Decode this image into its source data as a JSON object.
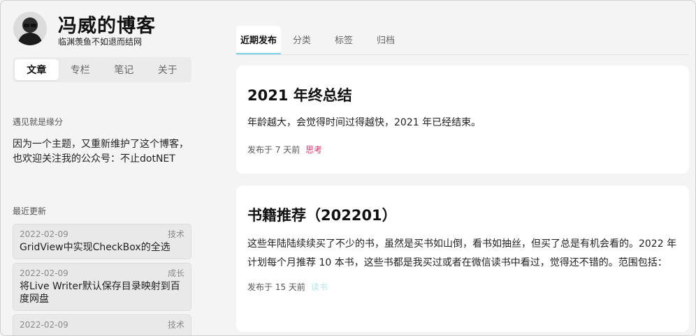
{
  "colors": {
    "accent": "#7dd0e4",
    "tag_think": "#d6336c",
    "tag_reading": "#b6e4ef",
    "background": "#f4f4f4",
    "card": "#ffffff"
  },
  "blog": {
    "title": "冯威的博客",
    "subtitle": "临渊羡鱼不如退而结网"
  },
  "sidebar": {
    "tabs": [
      {
        "label": "文章",
        "active": true
      },
      {
        "label": "专栏",
        "active": false
      },
      {
        "label": "笔记",
        "active": false
      },
      {
        "label": "关于",
        "active": false
      }
    ],
    "intro_heading": "遇见就是缘分",
    "intro_text": "因为一个主题，又重新维护了这个博客，也欢迎关注我的公众号：不止dotNET",
    "recent_heading": "最近更新",
    "recent": [
      {
        "date": "2022-02-09",
        "category": "技术",
        "title": "GridView中实现CheckBox的全选"
      },
      {
        "date": "2022-02-09",
        "category": "成长",
        "title": "将Live Writer默认保存目录映射到百度网盘"
      },
      {
        "date": "2022-02-09",
        "category": "技术",
        "title": ""
      }
    ]
  },
  "main": {
    "tabs": [
      {
        "label": "近期发布",
        "active": true
      },
      {
        "label": "分类",
        "active": false
      },
      {
        "label": "标签",
        "active": false
      },
      {
        "label": "归档",
        "active": false
      }
    ],
    "posts": [
      {
        "title": "2021 年终总结",
        "excerpt": "年龄越大，会觉得时间过得越快，2021 年已经结束。",
        "published": "发布于 7 天前",
        "tag": "思考"
      },
      {
        "title": "书籍推荐（202201）",
        "excerpt": "这些年陆陆续续买了不少的书，虽然是买书如山倒，看书如抽丝，但买了总是有机会看的。2022 年计划每个月推荐 10 本书，这些书都是我买过或者在微信读书中看过，觉得还不错的。范围包括：",
        "published": "发布于 15 天前",
        "tag": "读书"
      }
    ]
  }
}
